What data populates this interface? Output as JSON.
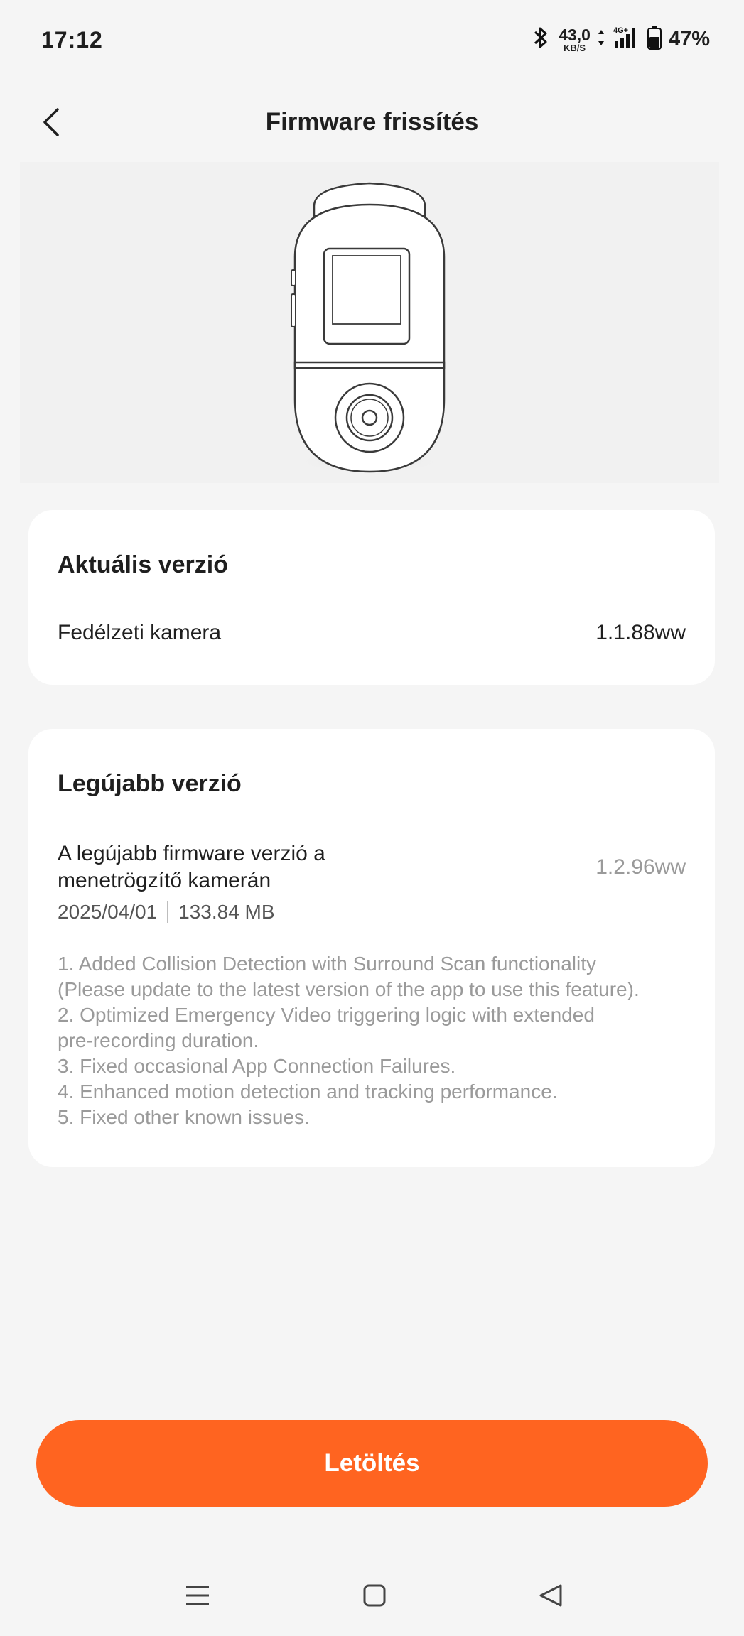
{
  "status_bar": {
    "time": "17:12",
    "net_speed_value": "43,0",
    "net_speed_unit": "KB/S",
    "network_type": "4G+",
    "battery_percent": "47%"
  },
  "header": {
    "title": "Firmware frissítés",
    "back_icon": "chevron-left-icon"
  },
  "device": {
    "illustration": "dashcam-illustration"
  },
  "current_version": {
    "title": "Aktuális verzió",
    "label": "Fedélzeti kamera",
    "value": "1.1.88ww"
  },
  "latest_version": {
    "title": "Legújabb verzió",
    "description": "A legújabb firmware verzió a menetrögzítő kamerán",
    "version": "1.2.96ww",
    "date": "2025/04/01",
    "size": "133.84 MB",
    "notes": [
      "1. Added Collision Detection with Surround Scan functionality",
      "(Please update to the latest version of the app to use this feature).",
      "2. Optimized Emergency Video triggering logic with extended",
      "pre-recording duration.",
      "3. Fixed occasional App Connection Failures.",
      "4. Enhanced motion detection and tracking performance.",
      "5. Fixed other known issues."
    ]
  },
  "download_button": {
    "label": "Letöltés"
  },
  "colors": {
    "accent": "#ff6420",
    "background": "#f5f5f5",
    "card": "#ffffff",
    "muted_text": "#9a9a9a"
  }
}
